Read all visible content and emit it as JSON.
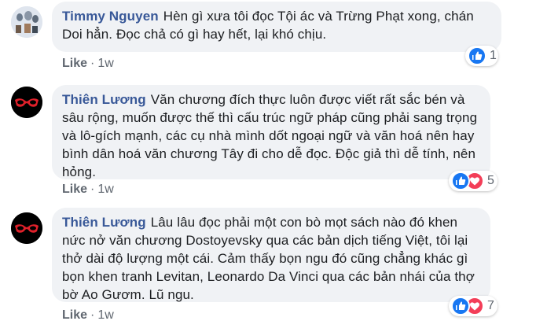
{
  "comments": [
    {
      "author": "Timmy Nguyen",
      "text": "Hèn gì xưa tôi đọc Tội ác và Trừng Phạt xong, chán Doi hẳn. Đọc chả có gì hay hết, lại khó chịu.",
      "like_label": "Like",
      "separator": "·",
      "time": "1w",
      "reaction_count": "1",
      "reactions": [
        "like"
      ]
    },
    {
      "author": "Thiên Lương",
      "text": "Văn chương đích thực luôn được viết rất sắc bén và sâu rộng, muốn được thế thì cấu trúc ngữ pháp cũng phải sang trọng và lô-gích mạnh, các cụ nhà mình dốt ngoại ngữ và văn hoá nên hay bình dân hoá văn chương Tây đi cho dễ đọc. Độc giả thì dễ tính, nên hỏng.",
      "like_label": "Like",
      "separator": "·",
      "time": "1w",
      "reaction_count": "5",
      "reactions": [
        "like",
        "love"
      ]
    },
    {
      "author": "Thiên Lương",
      "text": "Lâu lâu đọc phải một con bò mọt sách nào đó khen nức nở văn chương Dostoyevsky qua các bản dịch tiếng Việt, tôi lại thở dài độ lượng một cái. Cảm thấy bọn ngu đó cũng chẳng khác gì bọn khen tranh Levitan, Leonardo Da Vinci qua các bản nhái của thợ bờ Ao Gươm. Lũ ngu.",
      "like_label": "Like",
      "separator": "·",
      "time": "1w",
      "reaction_count": "7",
      "reactions": [
        "like",
        "love"
      ]
    }
  ],
  "colors": {
    "name": "#385898",
    "bubble": "#f0f2f5",
    "text": "#1c1e21",
    "meta": "#606770",
    "like": "#1877f2",
    "love": "#f33e58"
  }
}
